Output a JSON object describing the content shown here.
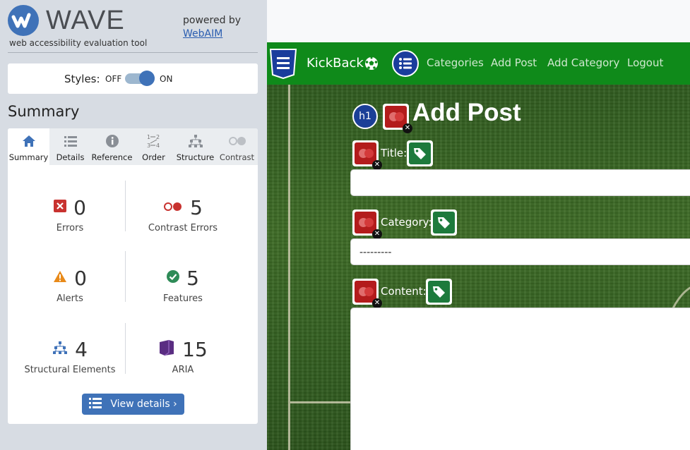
{
  "wave": {
    "brand": "WAVE",
    "tagline": "web accessibility evaluation tool",
    "powered_by": "powered by",
    "webaim_link": "WebAIM",
    "styles_label": "Styles:",
    "styles_off": "OFF",
    "styles_on": "ON",
    "summary_heading": "Summary",
    "tabs": [
      {
        "label": "Summary",
        "icon": "home-icon"
      },
      {
        "label": "Details",
        "icon": "list-icon"
      },
      {
        "label": "Reference",
        "icon": "info-icon"
      },
      {
        "label": "Order",
        "icon": "order-icon"
      },
      {
        "label": "Structure",
        "icon": "structure-icon"
      },
      {
        "label": "Contrast",
        "icon": "contrast-icon"
      }
    ],
    "stats": {
      "errors": {
        "count": "0",
        "label": "Errors"
      },
      "contrast_errors": {
        "count": "5",
        "label": "Contrast Errors"
      },
      "alerts": {
        "count": "0",
        "label": "Alerts"
      },
      "features": {
        "count": "5",
        "label": "Features"
      },
      "structural": {
        "count": "4",
        "label": "Structural Elements"
      },
      "aria": {
        "count": "15",
        "label": "ARIA"
      }
    },
    "view_details": "View details ›",
    "colors": {
      "accent": "#3f72b8",
      "error": "#c8322f",
      "alert": "#e88a1a",
      "feature": "#2e8b57",
      "aria": "#5a2d82"
    }
  },
  "site": {
    "brand": "KickBack",
    "nav": [
      "Categories",
      "Add Post",
      "Add Category",
      "Logout"
    ],
    "page_title": "Add Post",
    "h1_badge": "h1",
    "fields": {
      "title_label": "Title:",
      "category_label": "Category:",
      "category_value": "---------",
      "content_label": "Content:"
    },
    "colors": {
      "navbar": "#0f8a1a",
      "h1_badge": "#1b3f97"
    }
  }
}
